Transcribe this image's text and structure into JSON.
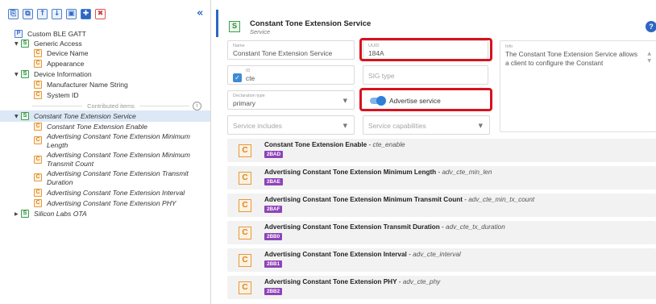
{
  "toolbar": {
    "buttons": [
      "⎘",
      "⧉",
      "↑",
      "↓",
      "▣",
      "✚",
      "✖"
    ],
    "collapse": "«"
  },
  "tree": {
    "root_label": "Custom BLE GATT",
    "generic_access": "Generic Access",
    "device_name": "Device Name",
    "appearance": "Appearance",
    "device_information": "Device Information",
    "manufacturer_name": "Manufacturer Name String",
    "system_id": "System ID",
    "contributed_items": "Contributed items",
    "cte_service": "Constant Tone Extension Service",
    "cte_enable": "Constant Tone Extension Enable",
    "adv_min_length": "Advertising Constant Tone Extension Minimum Length",
    "adv_min_tx_count": "Advertising Constant Tone Extension Minimum Transmit Count",
    "adv_tx_duration": "Advertising Constant Tone Extension Transmit Duration",
    "adv_interval": "Advertising Constant Tone Extension Interval",
    "adv_phy": "Advertising Constant Tone Extension PHY",
    "silicon_labs_ota": "Silicon Labs OTA",
    "badge_p": "P",
    "badge_s": "S",
    "badge_c": "C"
  },
  "service": {
    "badge": "S",
    "title": "Constant Tone Extension Service",
    "subtitle": "Service",
    "help": "?",
    "name_label": "Name",
    "name_value": "Constant Tone Extension Service",
    "uuid_label": "UUID",
    "uuid_value": "184A",
    "info_label": "Info",
    "info_text": "The Constant Tone Extension Service allows a client to configure the Constant",
    "id_label": "ID",
    "id_value": "cte",
    "sig_type_placeholder": "SIG type",
    "decl_label": "Declaration type",
    "decl_value": "primary",
    "advertise_label": "Advertise service",
    "advertise_on": true,
    "includes_placeholder": "Service includes",
    "capabilities_placeholder": "Service capabilities"
  },
  "characteristics": [
    {
      "name": "Constant Tone Extension Enable",
      "id": "cte_enable",
      "uuid": "2BAD"
    },
    {
      "name": "Advertising Constant Tone Extension Minimum Length",
      "id": "adv_cte_min_len",
      "uuid": "2BAE"
    },
    {
      "name": "Advertising Constant Tone Extension Minimum Transmit Count",
      "id": "adv_cte_min_tx_count",
      "uuid": "2BAF"
    },
    {
      "name": "Advertising Constant Tone Extension Transmit Duration",
      "id": "adv_cte_tx_duration",
      "uuid": "2BB0"
    },
    {
      "name": "Advertising Constant Tone Extension Interval",
      "id": "adv_cte_interval",
      "uuid": "2BB1"
    },
    {
      "name": "Advertising Constant Tone Extension PHY",
      "id": "adv_cte_phy",
      "uuid": "2BB2"
    }
  ],
  "colors": {
    "accent": "#2d66c4",
    "highlight_box": "#d8121f",
    "uuid_badge": "#8e44b8",
    "service_badge": "#3ea04e",
    "characteristic_badge": "#e49a3a"
  }
}
